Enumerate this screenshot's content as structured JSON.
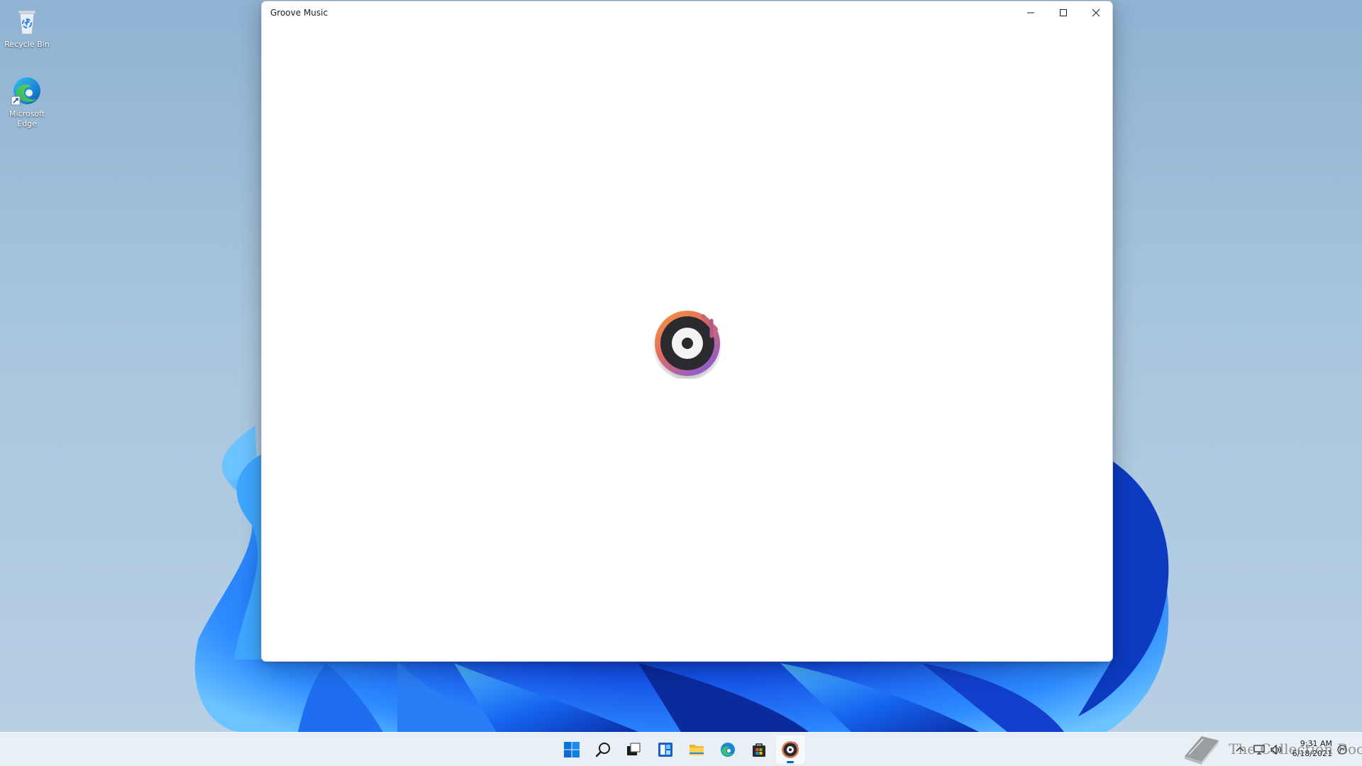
{
  "desktop": {
    "icons": [
      {
        "label": "Recycle Bin",
        "icon": "recycle-bin-icon"
      },
      {
        "label": "Microsoft Edge",
        "icon": "edge-icon"
      }
    ]
  },
  "window": {
    "title": "Groove Music",
    "app_icon": "groove-music-logo",
    "controls": {
      "minimize": "minimize-icon",
      "maximize": "maximize-icon",
      "close": "close-icon"
    }
  },
  "taskbar": {
    "pinned": [
      {
        "name": "Start",
        "icon": "windows-logo-icon"
      },
      {
        "name": "Search",
        "icon": "search-icon"
      },
      {
        "name": "Task View",
        "icon": "task-view-icon"
      },
      {
        "name": "Widgets",
        "icon": "widgets-icon"
      },
      {
        "name": "File Explorer",
        "icon": "folder-icon"
      },
      {
        "name": "Microsoft Edge",
        "icon": "edge-icon"
      },
      {
        "name": "Microsoft Store",
        "icon": "store-icon"
      },
      {
        "name": "Groove Music",
        "icon": "groove-music-icon",
        "active": true
      }
    ],
    "tray": {
      "icons": [
        "chevron-up-icon",
        "network-icon",
        "volume-icon",
        "notification-icon"
      ],
      "time": "9:31 AM",
      "date": "6/18/2021"
    }
  },
  "watermark": {
    "text": "The Collection Book",
    "icon": "book-icon"
  },
  "colors": {
    "accent": "#0067c0",
    "groove_orange": "#ef7a3c",
    "groove_purple": "#9b5bc7",
    "wallpaper_blue": "#1a5fe0"
  }
}
